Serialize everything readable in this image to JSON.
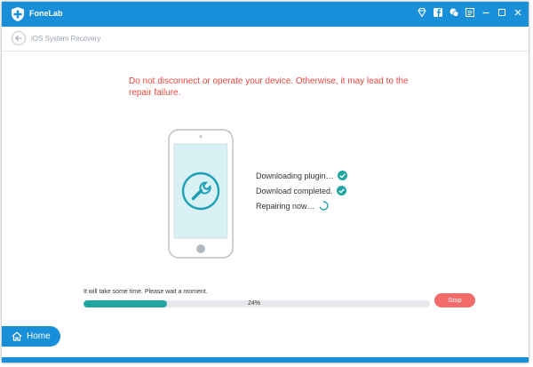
{
  "window": {
    "app_name": "FoneLab"
  },
  "titlebar": {
    "icons": [
      "diamond-icon",
      "facebook-icon",
      "chat-icon",
      "menu-icon",
      "minimize-icon",
      "maximize-icon",
      "close-icon"
    ]
  },
  "nav": {
    "back_icon": "back-arrow-icon",
    "breadcrumb": "iOS System Recovery"
  },
  "main": {
    "warning": "Do not disconnect or operate your device. Otherwise, it may lead to the repair failure.",
    "phone_icon": "wrench-icon",
    "steps": [
      {
        "label": "Downloading plugin…",
        "status": "done"
      },
      {
        "label": "Download completed.",
        "status": "done"
      },
      {
        "label": "Repairing now…",
        "status": "in-progress"
      }
    ]
  },
  "progress": {
    "note": "It will take some time. Please wait a moment.",
    "percent": 24,
    "percent_label": "24%",
    "stop_label": "Stop"
  },
  "footer": {
    "home_label": "Home"
  },
  "colors": {
    "accent": "#1a8fd9",
    "teal": "#20a6a2",
    "warning": "#e9473f",
    "stop": "#f26a6a"
  }
}
